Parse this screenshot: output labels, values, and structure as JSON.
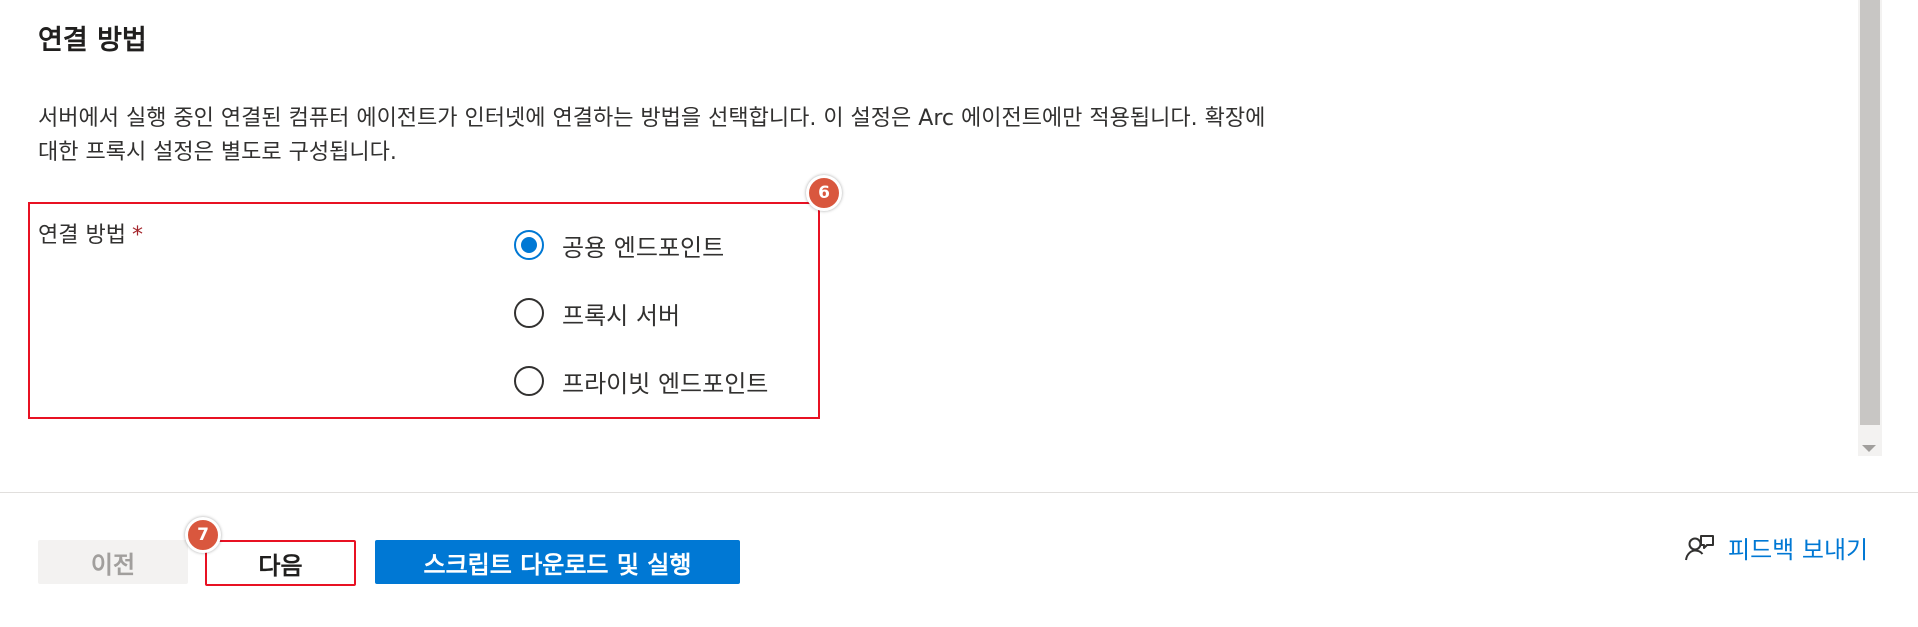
{
  "section": {
    "title": "연결 방법",
    "description_line1": "서버에서 실행 중인 연결된 컴퓨터 에이전트가 인터넷에 연결하는 방법을 선택합니다. 이 설정은 Arc 에이전트에만 적용됩니다. 확장에",
    "description_line2": "대한 프록시 설정은 별도로 구성됩니다."
  },
  "field": {
    "label": "연결 방법",
    "required_mark": "*",
    "options": [
      {
        "label": "공용 엔드포인트",
        "selected": true
      },
      {
        "label": "프록시 서버",
        "selected": false
      },
      {
        "label": "프라이빗 엔드포인트",
        "selected": false
      }
    ]
  },
  "annotations": {
    "badge_6": "6",
    "badge_7": "7"
  },
  "footer": {
    "prev_label": "이전",
    "next_label": "다음",
    "script_label": "스크립트 다운로드 및 실행",
    "feedback_label": "피드백 보내기",
    "feedback_icon": "feedback-person-icon"
  },
  "colors": {
    "accent": "#0078d4",
    "highlight": "#e81123",
    "badge": "#d9573e",
    "disabled_bg": "#f3f2f1"
  }
}
